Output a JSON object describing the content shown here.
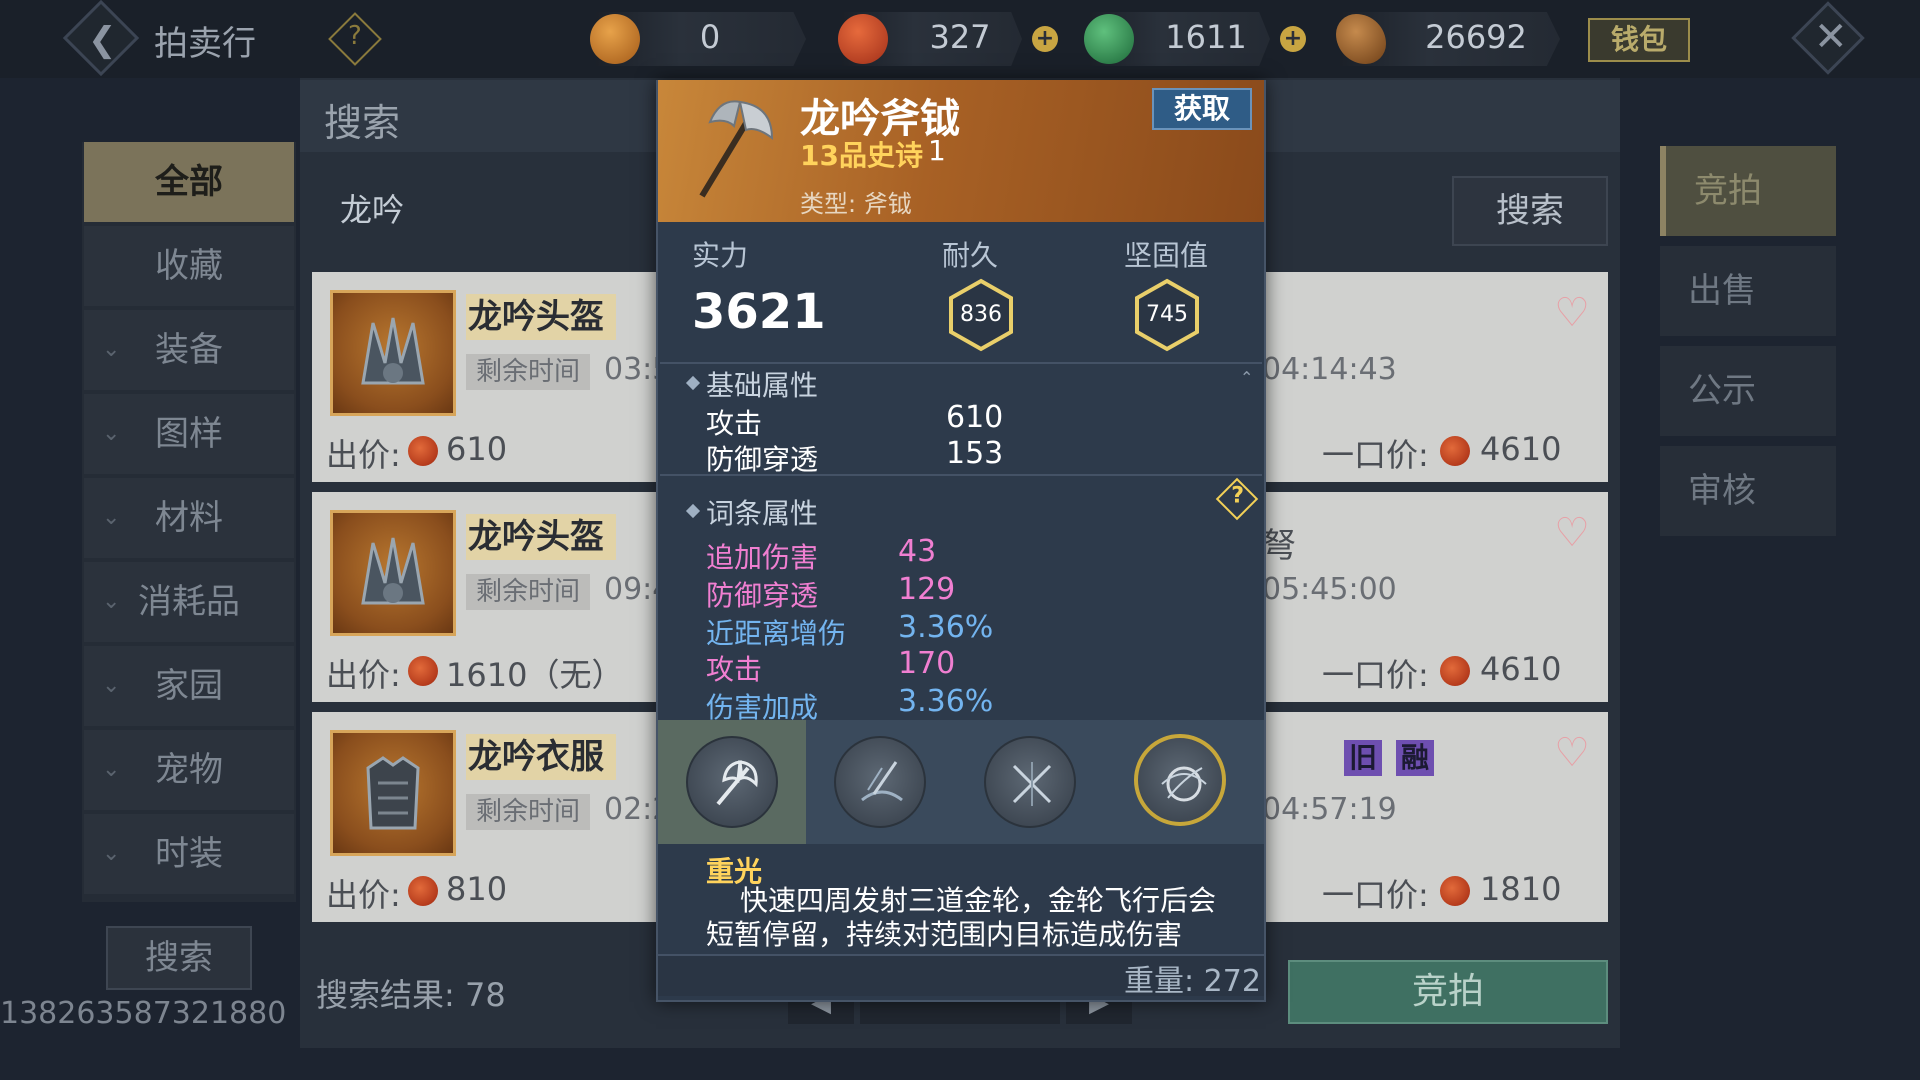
{
  "topbar": {
    "title": "拍卖行",
    "currencies": [
      {
        "icon": "bean-coin-icon",
        "value": "0"
      },
      {
        "icon": "red-coin-icon",
        "value": "327"
      },
      {
        "icon": "jade-coin-icon",
        "value": "1611"
      },
      {
        "icon": "feather-coin-icon",
        "value": "26692"
      }
    ],
    "wallet_label": "钱包"
  },
  "search_panel": {
    "header": "搜索",
    "input_value": "龙吟",
    "search_button": "搜索",
    "result_label": "搜索结果: 78",
    "bid_button": "竞拍"
  },
  "sidebar": {
    "items": [
      {
        "label": "全部",
        "active": true
      },
      {
        "label": "收藏"
      },
      {
        "label": "装备"
      },
      {
        "label": "图样"
      },
      {
        "label": "材料"
      },
      {
        "label": "消耗品"
      },
      {
        "label": "家园"
      },
      {
        "label": "宠物"
      },
      {
        "label": "时装"
      }
    ],
    "search_button": "搜索",
    "uid": "138263587321880"
  },
  "right_tabs": [
    "竞拍",
    "出售",
    "公示",
    "审核"
  ],
  "listings": [
    {
      "left": {
        "name": "龙吟头盔",
        "time_label": "剩余时间",
        "time_value": "03:5",
        "price_label": "出价:",
        "price": "610"
      },
      "right": {
        "time": "04:14:43",
        "buy_label": "一口价:",
        "buy_price": "4610"
      }
    },
    {
      "left": {
        "name": "龙吟头盔",
        "time_label": "剩余时间",
        "time_value": "09:4",
        "price_label": "出价:",
        "price": "1610（无）"
      },
      "right": {
        "partial_name": "弩",
        "time": "05:45:00",
        "buy_label": "一口价:",
        "buy_price": "4610"
      }
    },
    {
      "left": {
        "name": "龙吟衣服",
        "time_label": "剩余时间",
        "time_value": "02:2",
        "price_label": "出价:",
        "price": "810"
      },
      "right": {
        "badges": [
          "旧",
          "融"
        ],
        "time": "04:57:19",
        "buy_label": "一口价:",
        "buy_price": "1810"
      }
    }
  ],
  "tooltip": {
    "name": "龙吟斧钺",
    "grade": "13品史诗",
    "grade_num": "1",
    "type": "类型: 斧钺",
    "get_button": "获取",
    "stats": {
      "power_label": "实力",
      "power": "3621",
      "durability_label": "耐久",
      "durability": "836",
      "firmness_label": "坚固值",
      "firmness": "745"
    },
    "base_section": "基础属性",
    "base_attrs": [
      {
        "name": "攻击",
        "value": "610"
      },
      {
        "name": "防御穿透",
        "value": "153"
      }
    ],
    "affix_section": "词条属性",
    "affix_attrs": [
      {
        "name": "追加伤害",
        "value": "43",
        "color": "#f07fd1"
      },
      {
        "name": "防御穿透",
        "value": "129",
        "color": "#f07fd1"
      },
      {
        "name": "近距离增伤",
        "value": "3.36%",
        "color": "#73b4ef"
      },
      {
        "name": "攻击",
        "value": "170",
        "color": "#f07fd1"
      },
      {
        "name": "伤害加成",
        "value": "3.36%",
        "color": "#73b4ef"
      }
    ],
    "skills": [
      "axe-skill-icon",
      "blade-wave-skill-icon",
      "cross-slash-skill-icon",
      "golden-wheel-skill-icon"
    ],
    "skill_name": "重光",
    "skill_desc": "快速四周发射三道金轮，金轮飞行后会短暂停留，持续对范围内目标造成伤害",
    "weight": "重量: 272"
  },
  "colors": {
    "accent_gold": "#ffd35c",
    "epic_orange": "#c8873a",
    "pink_attr": "#f07fd1",
    "blue_attr": "#73b4ef"
  }
}
